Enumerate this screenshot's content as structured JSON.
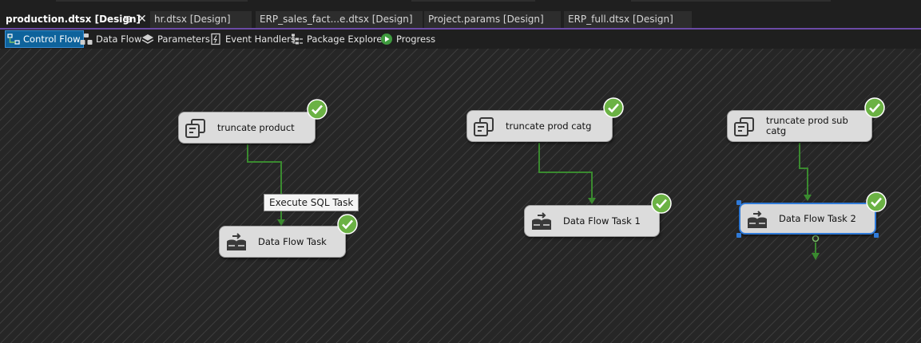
{
  "tabs": [
    {
      "label": "production.dtsx [Design]",
      "active": true,
      "pinned": true
    },
    {
      "label": "hr.dtsx [Design]"
    },
    {
      "label": "ERP_sales_fact...e.dtsx [Design]"
    },
    {
      "label": "Project.params [Design]"
    },
    {
      "label": "ERP_full.dtsx [Design]"
    }
  ],
  "toolbar": {
    "control_flow": "Control Flow",
    "data_flow": "Data Flow",
    "parameters": "Parameters",
    "event_handlers": "Event Handlers",
    "package_explorer": "Package Explorer",
    "progress": "Progress"
  },
  "tasks": {
    "truncate_product": {
      "label": "truncate product",
      "type": "Execute SQL Task",
      "status": "success"
    },
    "truncate_prod_catg": {
      "label": "truncate prod catg",
      "type": "Execute SQL Task",
      "status": "success"
    },
    "truncate_prod_sub_catg": {
      "label": "truncate prod sub catg",
      "type": "Execute SQL Task",
      "status": "success"
    },
    "data_flow_task": {
      "label": "Data Flow Task",
      "type": "Data Flow Task",
      "status": "success"
    },
    "data_flow_task_1": {
      "label": "Data Flow Task 1",
      "type": "Data Flow Task",
      "status": "success"
    },
    "data_flow_task_2": {
      "label": "Data Flow Task 2",
      "type": "Data Flow Task",
      "status": "success",
      "selected": true
    }
  },
  "tooltip": {
    "text": "Execute SQL Task"
  },
  "colors": {
    "accent": "#6b4aa6",
    "selection": "#2f7ad8",
    "precedence_success": "#3a8a2f",
    "success_badge": "#6bb244"
  }
}
